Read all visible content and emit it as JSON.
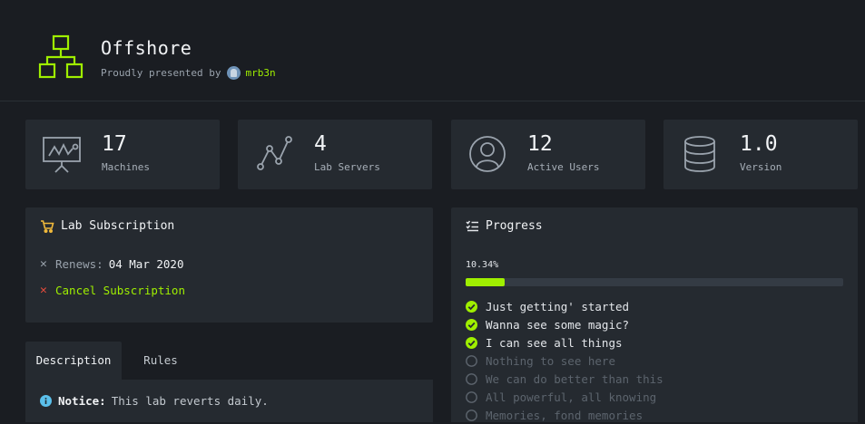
{
  "header": {
    "title": "Offshore",
    "presented_by": "Proudly presented by",
    "author": "mrb3n"
  },
  "stats": [
    {
      "value": "17",
      "label": "Machines",
      "icon": "presentation-chart-icon"
    },
    {
      "value": "4",
      "label": "Lab Servers",
      "icon": "line-graph-icon"
    },
    {
      "value": "12",
      "label": "Active Users",
      "icon": "user-circle-icon"
    },
    {
      "value": "1.0",
      "label": "Version",
      "icon": "database-icon"
    }
  ],
  "subscription": {
    "title": "Lab Subscription",
    "renews_label": "Renews:",
    "renews_date": "04 Mar 2020",
    "cancel_label": "Cancel Subscription"
  },
  "progress": {
    "title": "Progress",
    "percent_text": "10.34%",
    "percent_value": 10.34,
    "items": [
      {
        "label": "Just getting' started",
        "done": true
      },
      {
        "label": "Wanna see some magic?",
        "done": true
      },
      {
        "label": "I can see all things",
        "done": true
      },
      {
        "label": "Nothing to see here",
        "done": false
      },
      {
        "label": "We can do better than this",
        "done": false
      },
      {
        "label": "All powerful, all knowing",
        "done": false
      },
      {
        "label": "Memories, fond memories",
        "done": false
      }
    ]
  },
  "tabs": [
    {
      "label": "Description",
      "active": true
    },
    {
      "label": "Rules",
      "active": false
    }
  ],
  "notice": {
    "label": "Notice:",
    "text": "This lab reverts daily."
  },
  "colors": {
    "accent": "#9fef00",
    "background": "#1a1d22",
    "card": "#252a30",
    "cancel_x": "#e74c3c",
    "cart": "#f0b93b",
    "info": "#5bc0eb"
  }
}
